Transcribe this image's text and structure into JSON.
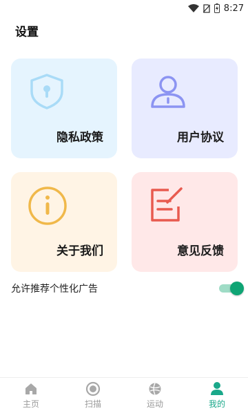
{
  "status_bar": {
    "time": "8:27",
    "icons": [
      "wifi-icon",
      "no-sim-icon",
      "battery-charging-icon"
    ]
  },
  "page": {
    "title": "设置"
  },
  "cards": [
    {
      "label": "隐私政策",
      "icon": "shield-lock-icon",
      "bg": "#e5f4fe",
      "icon_color": "#a9dbf7"
    },
    {
      "label": "用户协议",
      "icon": "user-icon",
      "bg": "#e8ebff",
      "icon_color": "#8c94f2"
    },
    {
      "label": "关于我们",
      "icon": "info-icon",
      "bg": "#fff4e5",
      "icon_color": "#f0b84a"
    },
    {
      "label": "意见反馈",
      "icon": "edit-icon",
      "bg": "#ffe8e8",
      "icon_color": "#e85a4f"
    }
  ],
  "settings": {
    "personalized_ads_label": "允许推荐个性化广告",
    "personalized_ads_enabled": true,
    "toggle_color": "#0fa474"
  },
  "tab_bar": {
    "active_color": "#1aa88a",
    "inactive_color": "#9a9a9a",
    "items": [
      {
        "label": "主页",
        "icon": "home-icon",
        "active": false
      },
      {
        "label": "扫描",
        "icon": "scan-icon",
        "active": false
      },
      {
        "label": "运动",
        "icon": "ball-icon",
        "active": false
      },
      {
        "label": "我的",
        "icon": "person-icon",
        "active": true
      }
    ]
  }
}
